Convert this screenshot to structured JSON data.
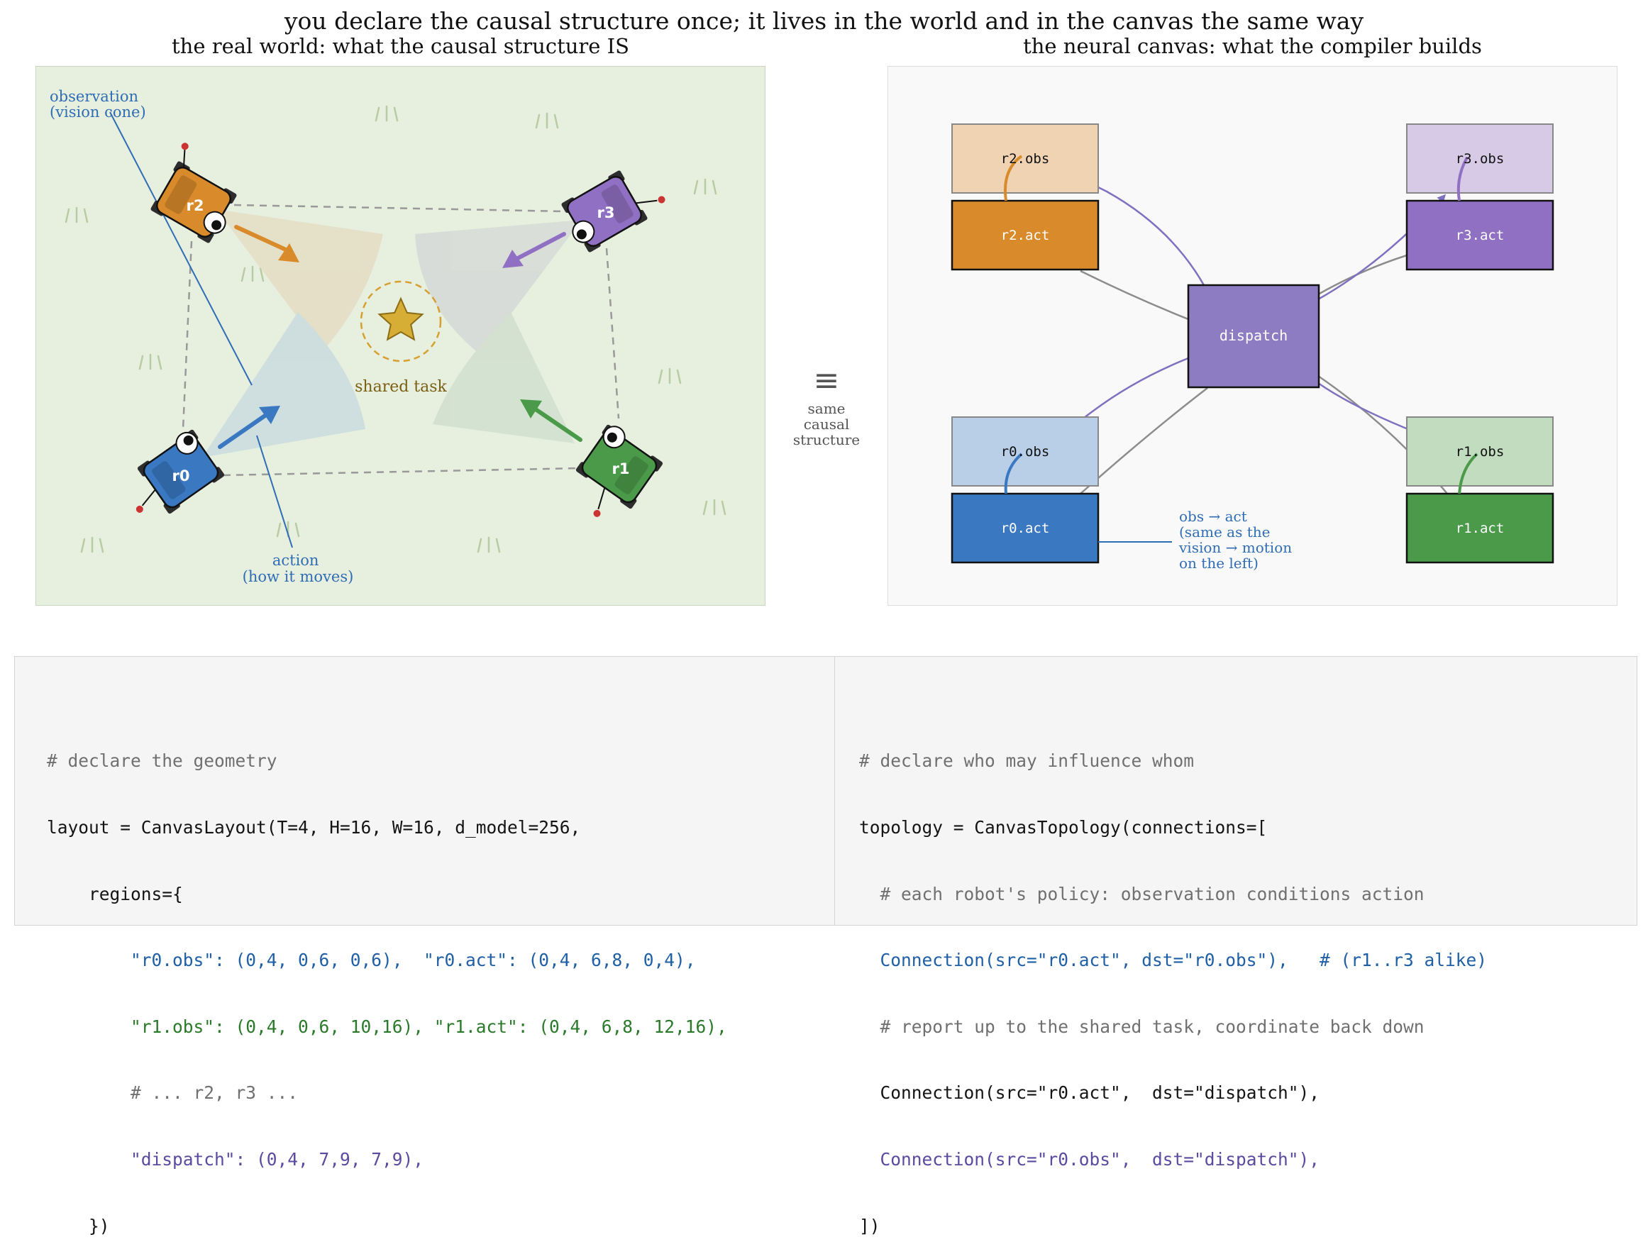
{
  "title": "you declare the causal structure once; it lives in the world and in the canvas the same way",
  "left_panel": {
    "subtitle": "the real world: what the causal structure IS",
    "observation_label": [
      "observation",
      "(vision cone)"
    ],
    "action_label": [
      "action",
      "(how it moves)"
    ],
    "task_label": "shared task",
    "robots": [
      {
        "id": "r0",
        "label": "r0",
        "color": "#3a78c2"
      },
      {
        "id": "r1",
        "label": "r1",
        "color": "#4a9a4a"
      },
      {
        "id": "r2",
        "label": "r2",
        "color": "#d98b2c"
      },
      {
        "id": "r3",
        "label": "r3",
        "color": "#9070c2"
      }
    ],
    "colors": {
      "background": "#e7efdf",
      "task_star": "#d6ad35",
      "annotation": "#2f6db5",
      "grass": "#b5c9a0"
    }
  },
  "middle": {
    "symbol": "≡",
    "caption": [
      "same",
      "causal",
      "structure"
    ]
  },
  "right_panel": {
    "subtitle": "the neural canvas: what the compiler builds",
    "boxes": {
      "r2_obs": "r2.obs",
      "r2_act": "r2.act",
      "r3_obs": "r3.obs",
      "r3_act": "r3.act",
      "r0_obs": "r0.obs",
      "r0_act": "r0.act",
      "r1_obs": "r1.obs",
      "r1_act": "r1.act",
      "dispatch": "dispatch"
    },
    "annotation": [
      "obs → act",
      "(same as the",
      "vision → motion",
      "on the left)"
    ],
    "colors": {
      "dispatch": "#8e7cc3",
      "purple_edge": "#8070c0",
      "gray_edge": "#8c8c8c"
    }
  },
  "code_left": [
    {
      "text": "# declare the geometry",
      "style": "comment"
    },
    {
      "text": "layout = CanvasLayout(T=4, H=16, W=16, d_model=256,",
      "style": "plain"
    },
    {
      "text": "    regions={",
      "style": "plain"
    },
    {
      "text": "        \"r0.obs\": (0,4, 0,6, 0,6),  \"r0.act\": (0,4, 6,8, 0,4),",
      "style": "blue"
    },
    {
      "text": "        \"r1.obs\": (0,4, 0,6, 10,16), \"r1.act\": (0,4, 6,8, 12,16),",
      "style": "green"
    },
    {
      "text": "        # ... r2, r3 ...",
      "style": "comment"
    },
    {
      "text": "        \"dispatch\": (0,4, 7,9, 7,9),",
      "style": "purple"
    },
    {
      "text": "    })",
      "style": "plain"
    }
  ],
  "code_right": [
    {
      "text": "# declare who may influence whom",
      "style": "comment"
    },
    {
      "text": "topology = CanvasTopology(connections=[",
      "style": "plain"
    },
    {
      "text": "  # each robot's policy: observation conditions action",
      "style": "comment"
    },
    {
      "text": "  Connection(src=\"r0.act\", dst=\"r0.obs\"),   # (r1..r3 alike)",
      "style": "blue"
    },
    {
      "text": "  # report up to the shared task, coordinate back down",
      "style": "comment"
    },
    {
      "text": "  Connection(src=\"r0.act\",  dst=\"dispatch\"),",
      "style": "plain"
    },
    {
      "text": "  Connection(src=\"r0.obs\",  dst=\"dispatch\"),",
      "style": "purple"
    },
    {
      "text": "])",
      "style": "plain"
    }
  ]
}
